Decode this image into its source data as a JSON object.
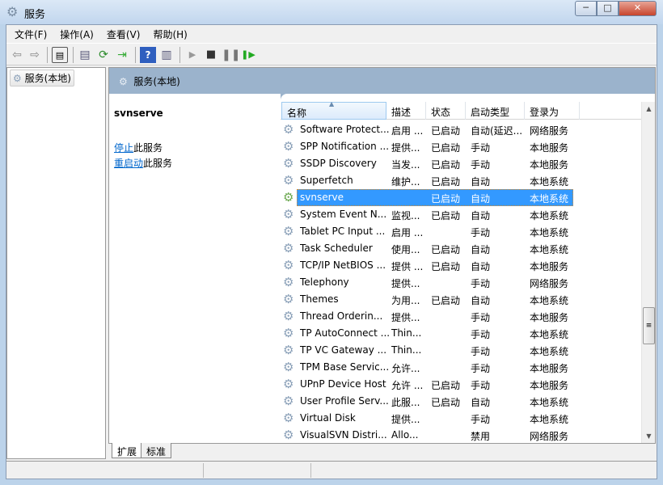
{
  "window": {
    "title": "服务",
    "minimize": "─",
    "maximize": "□",
    "close": "✕"
  },
  "menu": [
    "文件(F)",
    "操作(A)",
    "查看(V)",
    "帮助(H)"
  ],
  "toolbar": {
    "icons": [
      "back-icon",
      "forward-icon",
      "show-hide-console-tree-icon",
      "properties-icon",
      "refresh-icon",
      "export-list-icon",
      "help-icon",
      "show-hide-action-pane-icon",
      "start-service-icon",
      "stop-service-icon",
      "pause-service-icon",
      "resume-service-icon"
    ]
  },
  "tree": {
    "root": "服务(本地)"
  },
  "pane": {
    "title": "服务(本地)"
  },
  "detail": {
    "service_name": "svnserve",
    "stop_link": "停止",
    "stop_suffix": "此服务",
    "restart_link": "重启动",
    "restart_suffix": "此服务"
  },
  "columns": [
    "名称",
    "描述",
    "状态",
    "启动类型",
    "登录为"
  ],
  "rows": [
    {
      "name": "Software Protect...",
      "desc": "启用 ...",
      "status": "已启动",
      "startup": "自动(延迟...",
      "logon": "网络服务"
    },
    {
      "name": "SPP Notification ...",
      "desc": "提供...",
      "status": "已启动",
      "startup": "手动",
      "logon": "本地服务"
    },
    {
      "name": "SSDP Discovery",
      "desc": "当发...",
      "status": "已启动",
      "startup": "手动",
      "logon": "本地服务"
    },
    {
      "name": "Superfetch",
      "desc": "维护...",
      "status": "已启动",
      "startup": "自动",
      "logon": "本地系统"
    },
    {
      "name": "svnserve",
      "desc": "",
      "status": "已启动",
      "startup": "自动",
      "logon": "本地系统",
      "selected": true
    },
    {
      "name": "System Event N...",
      "desc": "监视...",
      "status": "已启动",
      "startup": "自动",
      "logon": "本地系统"
    },
    {
      "name": "Tablet PC Input ...",
      "desc": "启用 ...",
      "status": "",
      "startup": "手动",
      "logon": "本地系统"
    },
    {
      "name": "Task Scheduler",
      "desc": "使用...",
      "status": "已启动",
      "startup": "自动",
      "logon": "本地系统"
    },
    {
      "name": "TCP/IP NetBIOS ...",
      "desc": "提供 ...",
      "status": "已启动",
      "startup": "自动",
      "logon": "本地服务"
    },
    {
      "name": "Telephony",
      "desc": "提供...",
      "status": "",
      "startup": "手动",
      "logon": "网络服务"
    },
    {
      "name": "Themes",
      "desc": "为用...",
      "status": "已启动",
      "startup": "自动",
      "logon": "本地系统"
    },
    {
      "name": "Thread Orderin...",
      "desc": "提供...",
      "status": "",
      "startup": "手动",
      "logon": "本地服务"
    },
    {
      "name": "TP AutoConnect ...",
      "desc": "Thin...",
      "status": "",
      "startup": "手动",
      "logon": "本地系统"
    },
    {
      "name": "TP VC Gateway ...",
      "desc": "Thin...",
      "status": "",
      "startup": "手动",
      "logon": "本地系统"
    },
    {
      "name": "TPM Base Servic...",
      "desc": "允许...",
      "status": "",
      "startup": "手动",
      "logon": "本地服务"
    },
    {
      "name": "UPnP Device Host",
      "desc": "允许 ...",
      "status": "已启动",
      "startup": "手动",
      "logon": "本地服务"
    },
    {
      "name": "User Profile Serv...",
      "desc": "此服...",
      "status": "已启动",
      "startup": "自动",
      "logon": "本地系统"
    },
    {
      "name": "Virtual Disk",
      "desc": "提供...",
      "status": "",
      "startup": "手动",
      "logon": "本地系统"
    },
    {
      "name": "VisualSVN Distri...",
      "desc": "Allo...",
      "status": "",
      "startup": "禁用",
      "logon": "网络服务"
    }
  ],
  "tabs": [
    "扩展",
    "标准"
  ],
  "colors": {
    "selection": "#3399ff",
    "band": "#9bb3cc",
    "link": "#0066cc"
  }
}
